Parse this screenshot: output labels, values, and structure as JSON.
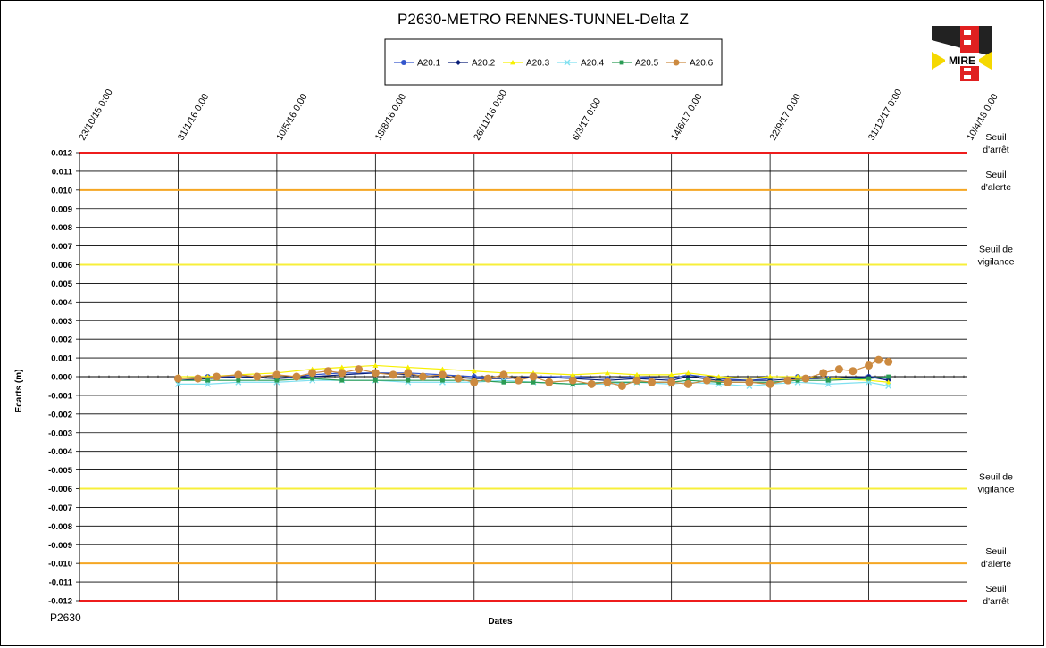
{
  "chart_data": {
    "type": "scatter",
    "title": "P2630-METRO  RENNES-TUNNEL-Delta  Z",
    "xlabel": "Dates",
    "ylabel": "Ecarts (m)",
    "ylim": [
      -0.012,
      0.012
    ],
    "xlim": [
      "2015-10-23",
      "2018-04-10"
    ],
    "x_ticks": [
      "23/10/15 0:00",
      "31/1/16 0:00",
      "10/5/16 0:00",
      "18/8/16 0:00",
      "26/11/16 0:00",
      "6/3/17 0:00",
      "14/6/17 0:00",
      "22/9/17 0:00",
      "31/12/17 0:00",
      "10/4/18 0:00"
    ],
    "y_ticks": [
      "0.012",
      "0.011",
      "0.010",
      "0.009",
      "0.008",
      "0.007",
      "0.006",
      "0.005",
      "0.004",
      "0.003",
      "0.002",
      "0.001",
      "0.000",
      "-0.001",
      "-0.002",
      "-0.003",
      "-0.004",
      "-0.005",
      "-0.006",
      "-0.007",
      "-0.008",
      "-0.009",
      "-0.010",
      "-0.011",
      "-0.012"
    ],
    "grid": true,
    "legend_position": "top-center",
    "thresholds": [
      {
        "label_line1": "Seuil",
        "label_line2": "d'arrêt",
        "value": 0.012,
        "color": "#ee1c1c"
      },
      {
        "label_line1": "Seuil",
        "label_line2": "d'alerte",
        "value": 0.01,
        "color": "#f5a623"
      },
      {
        "label_line1": "Seuil de",
        "label_line2": "vigilance",
        "value": 0.006,
        "color": "#f7ef3a"
      },
      {
        "label_line1": "Seuil de",
        "label_line2": "vigilance",
        "value": -0.006,
        "color": "#f7ef3a"
      },
      {
        "label_line1": "Seuil",
        "label_line2": "d'alerte",
        "value": -0.01,
        "color": "#f5a623"
      },
      {
        "label_line1": "Seuil",
        "label_line2": "d'arrêt",
        "value": -0.012,
        "color": "#ee1c1c"
      }
    ],
    "series": [
      {
        "name": "A20.1",
        "color": "#3355cc",
        "marker": "circle",
        "x": [
          "2016-01-31",
          "2016-03-01",
          "2016-04-01",
          "2016-05-10",
          "2016-06-15",
          "2016-07-15",
          "2016-08-18",
          "2016-09-20",
          "2016-10-25",
          "2016-11-26",
          "2016-12-26",
          "2017-01-25",
          "2017-03-06",
          "2017-04-10",
          "2017-05-10",
          "2017-06-14",
          "2017-07-01",
          "2017-08-01",
          "2017-09-01",
          "2017-09-22",
          "2017-10-20",
          "2017-11-20",
          "2017-12-31",
          "2018-01-20"
        ],
        "values": [
          -0.0001,
          0.0,
          0.0,
          -0.0001,
          0.0001,
          0.0002,
          0.0002,
          0.0002,
          0.0001,
          0.0,
          -0.0001,
          0.0,
          0.0,
          -0.0001,
          0.0,
          -0.0001,
          0.0001,
          -0.0001,
          -0.0002,
          -0.0001,
          0.0,
          -0.0001,
          0.0,
          -0.0001
        ]
      },
      {
        "name": "A20.2",
        "color": "#0a1f78",
        "marker": "diamond",
        "x": [
          "2016-01-31",
          "2016-03-01",
          "2016-04-01",
          "2016-05-10",
          "2016-06-15",
          "2016-07-15",
          "2016-08-18",
          "2016-09-20",
          "2016-10-25",
          "2016-11-26",
          "2016-12-26",
          "2017-01-25",
          "2017-03-06",
          "2017-04-10",
          "2017-05-10",
          "2017-06-14",
          "2017-07-01",
          "2017-08-01",
          "2017-09-01",
          "2017-09-22",
          "2017-10-20",
          "2017-11-20",
          "2017-12-31",
          "2018-01-20"
        ],
        "values": [
          -0.0002,
          -0.0001,
          0.0,
          -0.0001,
          0.0,
          0.0001,
          0.0002,
          0.0001,
          0.0,
          -0.0001,
          -0.0001,
          0.0,
          -0.0001,
          -0.0002,
          -0.0001,
          -0.0002,
          0.0,
          -0.0002,
          -0.0002,
          -0.0002,
          -0.0001,
          -0.0001,
          0.0,
          -0.0002
        ]
      },
      {
        "name": "A20.3",
        "color": "#f7f000",
        "marker": "triangle",
        "x": [
          "2016-01-31",
          "2016-03-01",
          "2016-04-01",
          "2016-05-10",
          "2016-06-15",
          "2016-07-15",
          "2016-08-18",
          "2016-09-20",
          "2016-10-25",
          "2016-11-26",
          "2016-12-26",
          "2017-01-25",
          "2017-03-06",
          "2017-04-10",
          "2017-05-10",
          "2017-06-14",
          "2017-07-01",
          "2017-08-01",
          "2017-09-01",
          "2017-09-22",
          "2017-10-20",
          "2017-11-20",
          "2017-12-31",
          "2018-01-20"
        ],
        "values": [
          0.0,
          0.0,
          0.0001,
          0.0002,
          0.0004,
          0.0005,
          0.0006,
          0.0005,
          0.0004,
          0.0003,
          0.0002,
          0.0002,
          0.0001,
          0.0002,
          0.0001,
          0.0001,
          0.0002,
          0.0,
          -0.0001,
          0.0,
          0.0,
          -0.0001,
          -0.0002,
          -0.0003
        ]
      },
      {
        "name": "A20.4",
        "color": "#7fe0f0",
        "marker": "x",
        "x": [
          "2016-01-31",
          "2016-03-01",
          "2016-04-01",
          "2016-05-10",
          "2016-06-15",
          "2016-07-15",
          "2016-08-18",
          "2016-09-20",
          "2016-10-25",
          "2016-11-26",
          "2016-12-26",
          "2017-01-25",
          "2017-03-06",
          "2017-04-10",
          "2017-05-10",
          "2017-06-14",
          "2017-07-01",
          "2017-08-01",
          "2017-09-01",
          "2017-09-22",
          "2017-10-20",
          "2017-11-20",
          "2017-12-31",
          "2018-01-20"
        ],
        "values": [
          -0.0004,
          -0.0004,
          -0.0003,
          -0.0003,
          -0.0002,
          -0.0002,
          -0.0002,
          -0.0003,
          -0.0003,
          -0.0003,
          -0.0002,
          -0.0003,
          -0.0004,
          -0.0004,
          -0.0003,
          -0.0004,
          -0.0003,
          -0.0004,
          -0.0005,
          -0.0004,
          -0.0003,
          -0.0004,
          -0.0003,
          -0.0005
        ]
      },
      {
        "name": "A20.5",
        "color": "#2a9c54",
        "marker": "square",
        "x": [
          "2016-01-31",
          "2016-03-01",
          "2016-04-01",
          "2016-05-10",
          "2016-06-15",
          "2016-07-15",
          "2016-08-18",
          "2016-09-20",
          "2016-10-25",
          "2016-11-26",
          "2016-12-26",
          "2017-01-25",
          "2017-03-06",
          "2017-04-10",
          "2017-05-10",
          "2017-06-14",
          "2017-07-01",
          "2017-08-01",
          "2017-09-01",
          "2017-09-22",
          "2017-10-20",
          "2017-11-20",
          "2017-12-31",
          "2018-01-20"
        ],
        "values": [
          -0.0002,
          -0.0002,
          -0.0002,
          -0.0002,
          -0.0001,
          -0.0002,
          -0.0002,
          -0.0002,
          -0.0002,
          -0.0002,
          -0.0003,
          -0.0003,
          -0.0004,
          -0.0003,
          -0.0003,
          -0.0003,
          -0.0002,
          -0.0003,
          -0.0003,
          -0.0003,
          -0.0002,
          -0.0002,
          -0.0001,
          0.0
        ]
      },
      {
        "name": "A20.6",
        "color": "#cc8a40",
        "marker": "circle",
        "x": [
          "2016-01-31",
          "2016-02-20",
          "2016-03-10",
          "2016-04-01",
          "2016-04-20",
          "2016-05-10",
          "2016-05-30",
          "2016-06-15",
          "2016-07-01",
          "2016-07-15",
          "2016-08-01",
          "2016-08-18",
          "2016-09-05",
          "2016-09-20",
          "2016-10-05",
          "2016-10-25",
          "2016-11-10",
          "2016-11-26",
          "2016-12-10",
          "2016-12-26",
          "2017-01-10",
          "2017-01-25",
          "2017-02-10",
          "2017-03-06",
          "2017-03-25",
          "2017-04-10",
          "2017-04-25",
          "2017-05-10",
          "2017-05-25",
          "2017-06-14",
          "2017-07-01",
          "2017-07-20",
          "2017-08-10",
          "2017-09-01",
          "2017-09-22",
          "2017-10-10",
          "2017-10-28",
          "2017-11-15",
          "2017-12-01",
          "2017-12-15",
          "2017-12-31",
          "2018-01-10",
          "2018-01-20"
        ],
        "values": [
          -0.0001,
          -0.0001,
          0.0,
          0.0001,
          0.0,
          0.0001,
          0.0,
          0.0002,
          0.0003,
          0.0002,
          0.0004,
          0.0002,
          0.0001,
          0.0002,
          0.0,
          0.0001,
          -0.0001,
          -0.0003,
          -0.0001,
          0.0001,
          -0.0002,
          0.0,
          -0.0003,
          -0.0002,
          -0.0004,
          -0.0003,
          -0.0005,
          -0.0002,
          -0.0003,
          -0.0003,
          -0.0004,
          -0.0002,
          -0.0003,
          -0.0003,
          -0.0004,
          -0.0002,
          -0.0001,
          0.0002,
          0.0004,
          0.0003,
          0.0006,
          0.0009,
          0.0008
        ]
      }
    ]
  },
  "logo_text": "MIRE",
  "footer_label": "P2630"
}
